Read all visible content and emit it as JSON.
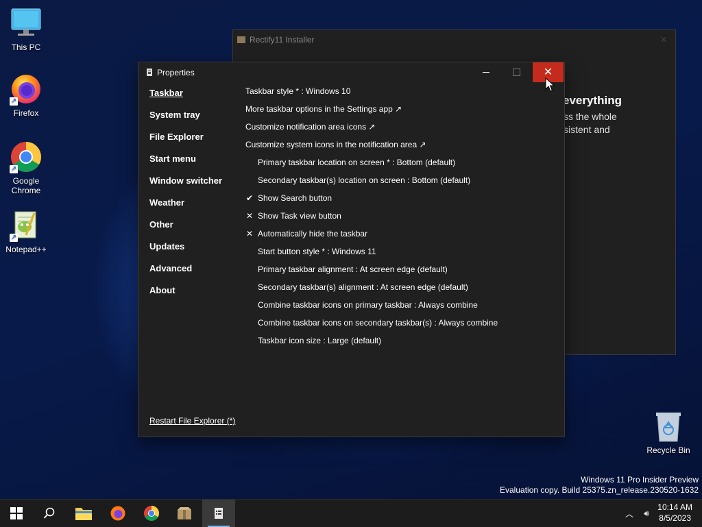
{
  "desktop": {
    "icons": [
      {
        "label": "This PC"
      },
      {
        "label": "Firefox"
      },
      {
        "label": "Google Chrome"
      },
      {
        "label": "Notepad++"
      },
      {
        "label": "Recycle Bin"
      }
    ]
  },
  "installer": {
    "title": "Rectify11 Installer",
    "heading": "everything",
    "lines": [
      "ss the whole",
      "sistent and"
    ]
  },
  "properties": {
    "title": "Properties",
    "sidebar": [
      {
        "label": "Taskbar",
        "active": true
      },
      {
        "label": "System tray"
      },
      {
        "label": "File Explorer"
      },
      {
        "label": "Start menu"
      },
      {
        "label": "Window switcher"
      },
      {
        "label": "Weather"
      },
      {
        "label": "Other"
      },
      {
        "label": "Updates"
      },
      {
        "label": "Advanced"
      },
      {
        "label": "About"
      }
    ],
    "options": [
      {
        "text": "Taskbar style * : Windows 10",
        "indent": false,
        "mark": ""
      },
      {
        "text": "More taskbar options in the Settings app ↗",
        "indent": false,
        "mark": ""
      },
      {
        "text": "Customize notification area icons ↗",
        "indent": false,
        "mark": ""
      },
      {
        "text": "Customize system icons in the notification area ↗",
        "indent": false,
        "mark": ""
      },
      {
        "text": "Primary taskbar location on screen * : Bottom (default)",
        "indent": true,
        "mark": ""
      },
      {
        "text": "Secondary taskbar(s) location on screen : Bottom (default)",
        "indent": true,
        "mark": ""
      },
      {
        "text": "Show Search button",
        "indent": true,
        "mark": "✔"
      },
      {
        "text": "Show Task view button",
        "indent": true,
        "mark": "✕"
      },
      {
        "text": "Automatically hide the taskbar",
        "indent": true,
        "mark": "✕"
      },
      {
        "text": "Start button style * : Windows 11",
        "indent": true,
        "mark": ""
      },
      {
        "text": "Primary taskbar alignment : At screen edge (default)",
        "indent": true,
        "mark": ""
      },
      {
        "text": "Secondary taskbar(s) alignment : At screen edge (default)",
        "indent": true,
        "mark": ""
      },
      {
        "text": "Combine taskbar icons on primary taskbar : Always combine",
        "indent": true,
        "mark": ""
      },
      {
        "text": "Combine taskbar icons on secondary taskbar(s) : Always combine",
        "indent": true,
        "mark": ""
      },
      {
        "text": "Taskbar icon size : Large (default)",
        "indent": true,
        "mark": ""
      }
    ],
    "restart_label": "Restart File Explorer (*)"
  },
  "watermark": {
    "line1": "Windows 11 Pro Insider Preview",
    "line2": "Evaluation copy. Build 25375.zn_release.230520-1632"
  },
  "taskbar": {
    "items": [
      "start-icon",
      "search-icon",
      "file-explorer-icon",
      "firefox-icon",
      "chrome-icon",
      "installer-icon",
      "properties-icon"
    ],
    "time": "10:14 AM",
    "date": "8/5/2023"
  },
  "colors": {
    "close_hover": "#c42b1c",
    "accent": "#76b9ed",
    "window_bg": "#202020"
  }
}
